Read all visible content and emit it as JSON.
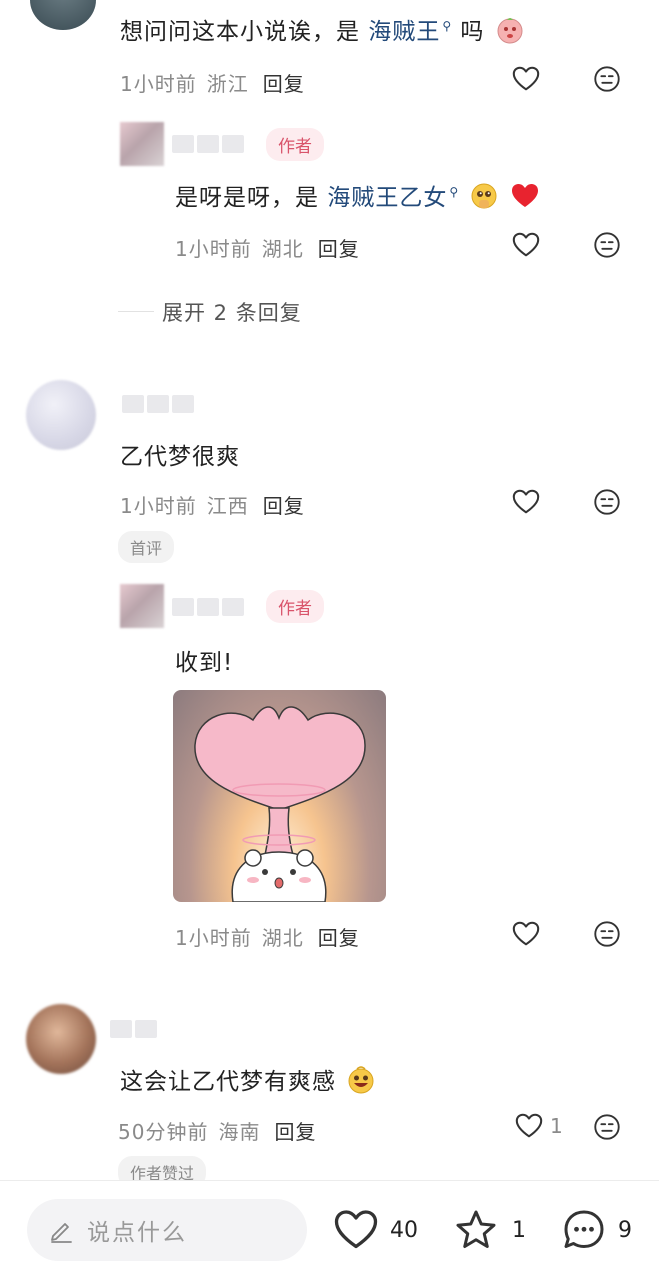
{
  "comments": [
    {
      "text_prefix": "想问问这本小说诶，是",
      "link": "海贼王",
      "text_suffix": "吗",
      "time": "1小时前",
      "location": "浙江",
      "reply_label": "回复"
    },
    {
      "author_tag": "作者",
      "text_prefix": "是呀是呀，是",
      "link": "海贼王乙女",
      "time": "1小时前",
      "location": "湖北",
      "reply_label": "回复"
    },
    {
      "expand_label": "展开 2 条回复"
    },
    {
      "text": "乙代梦很爽",
      "time": "1小时前",
      "location": "江西",
      "reply_label": "回复",
      "badge": "首评"
    },
    {
      "author_tag": "作者",
      "text": "收到!",
      "image_icon": "heart-mushroom-cloud-sticker",
      "time": "1小时前",
      "location": "湖北",
      "reply_label": "回复"
    },
    {
      "text": "这会让乙代梦有爽感",
      "time": "50分钟前",
      "location": "海南",
      "reply_label": "回复",
      "like_count": "1",
      "badge": "作者赞过"
    }
  ],
  "bottom_bar": {
    "input_placeholder": "说点什么",
    "like_count": "40",
    "favorite_count": "1",
    "comment_count": "9"
  },
  "colors": {
    "link": "#234a7a",
    "author_tag_text": "#d9546b",
    "author_tag_bg": "#fdecef",
    "heart_red": "#e8232f"
  },
  "icons": [
    "heart-outline-icon",
    "dislike-face-icon",
    "search-magnifier-icon",
    "edit-pencil-icon",
    "star-icon",
    "comment-bubble-icon"
  ]
}
